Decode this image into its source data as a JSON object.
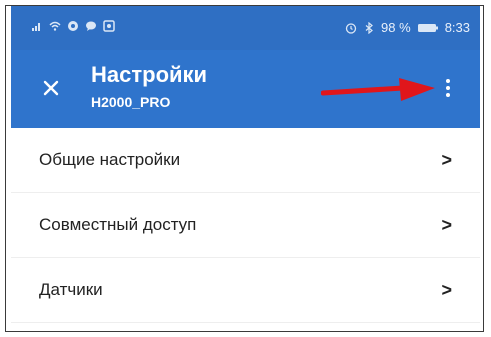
{
  "status_bar": {
    "battery_text": "98 %",
    "time": "8:33",
    "left_icons": [
      "signal-icon",
      "wifi-icon",
      "app-icon",
      "chat-icon",
      "gallery-icon"
    ],
    "right_icons": [
      "alarm-icon",
      "bluetooth-icon",
      "battery-icon"
    ]
  },
  "app_bar": {
    "title": "Настройки",
    "subtitle": "H2000_PRO",
    "close_icon": "close-icon",
    "menu_icon": "more-vertical-icon",
    "annotation_color": "#e0161b",
    "bar_color": "#2f74cc"
  },
  "settings": {
    "items": [
      {
        "label": "Общие настройки"
      },
      {
        "label": "Совместный доступ"
      },
      {
        "label": "Датчики"
      }
    ]
  }
}
